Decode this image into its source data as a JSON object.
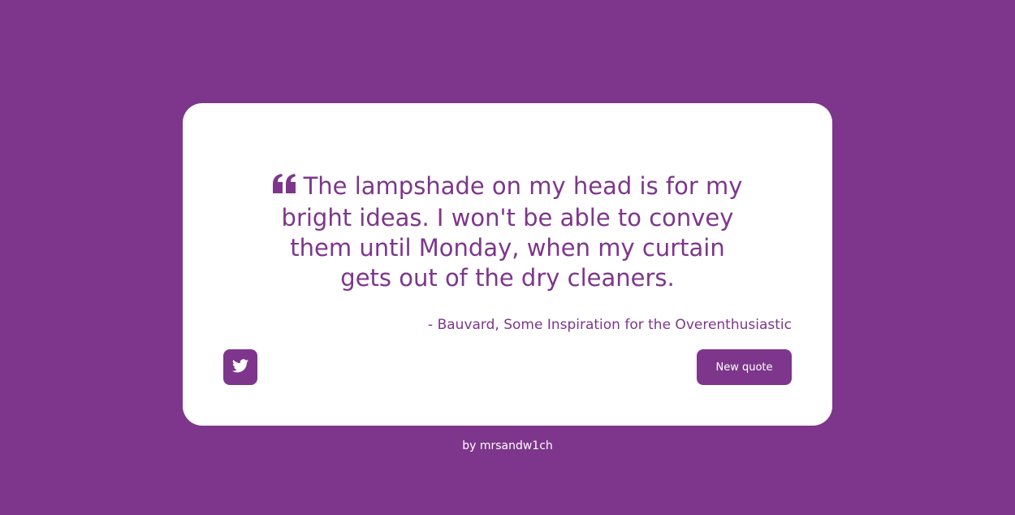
{
  "colors": {
    "background": "#7d368b",
    "card": "#ffffff",
    "accent": "#7d368b",
    "button_text": "#ffffff"
  },
  "quote": {
    "icon": "quote-left-icon",
    "text": "The lampshade on my head is for my bright ideas. I won't be able to convey them until Monday, when my curtain gets out of the dry cleaners.",
    "author": "- Bauvard, Some Inspiration for the Overenthusiastic"
  },
  "actions": {
    "tweet_icon": "twitter-icon",
    "new_quote_label": "New quote"
  },
  "footer": {
    "credit": "by mrsandw1ch"
  }
}
